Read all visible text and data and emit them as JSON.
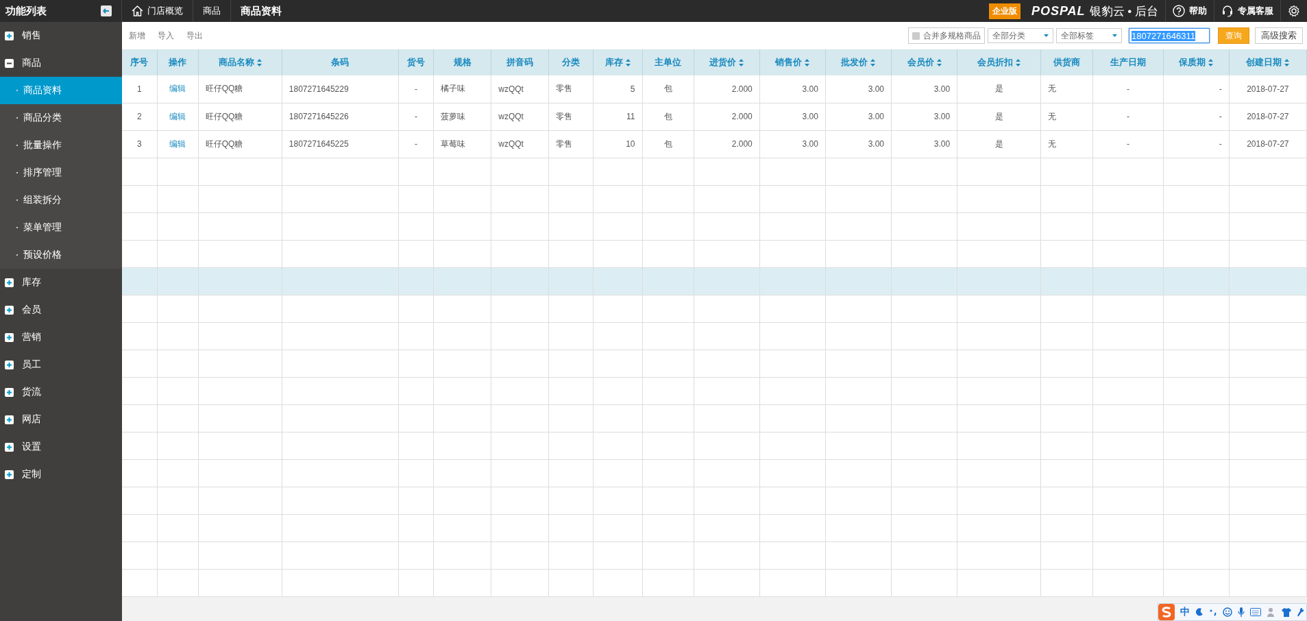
{
  "sidebar": {
    "title": "功能列表",
    "groups": [
      {
        "label": "销售",
        "expanded": false
      },
      {
        "label": "商品",
        "expanded": true,
        "children": [
          {
            "label": "商品资料",
            "selected": true
          },
          {
            "label": "商品分类",
            "selected": false
          },
          {
            "label": "批量操作",
            "selected": false
          },
          {
            "label": "排序管理",
            "selected": false
          },
          {
            "label": "组装拆分",
            "selected": false
          },
          {
            "label": "菜单管理",
            "selected": false
          },
          {
            "label": "预设价格",
            "selected": false
          }
        ]
      },
      {
        "label": "库存",
        "expanded": false
      },
      {
        "label": "会员",
        "expanded": false
      },
      {
        "label": "营销",
        "expanded": false
      },
      {
        "label": "员工",
        "expanded": false
      },
      {
        "label": "货流",
        "expanded": false
      },
      {
        "label": "网店",
        "expanded": false
      },
      {
        "label": "设置",
        "expanded": false
      },
      {
        "label": "定制",
        "expanded": false
      }
    ]
  },
  "breadcrumb": [
    {
      "label": "门店概览",
      "kind": "home",
      "current": false
    },
    {
      "label": "商品",
      "kind": "plain",
      "current": false
    },
    {
      "label": "商品资料",
      "kind": "plain",
      "current": true
    }
  ],
  "header_right": {
    "edition_badge": "企业版",
    "brand": "POSPAL",
    "product": "银豹云",
    "separator": "•",
    "suffix": "后台",
    "links": [
      {
        "label": "帮助",
        "kind": "help"
      },
      {
        "label": "专属客服",
        "kind": "service"
      },
      {
        "kind": "settings"
      }
    ]
  },
  "toolbar": {
    "actions": [
      "新增",
      "导入",
      "导出"
    ],
    "merge_checkbox": {
      "label": "合并多规格商品",
      "checked": false
    },
    "filters": [
      "全部分类",
      "全部标签"
    ],
    "search": {
      "value": "1807271646311",
      "text_selected": true
    },
    "query_button": "查询",
    "advanced_button": "高级搜索"
  },
  "table": {
    "columns": [
      {
        "label": "序号",
        "sortable": false
      },
      {
        "label": "操作",
        "sortable": false
      },
      {
        "label": "商品名称",
        "sortable": true
      },
      {
        "label": "条码",
        "sortable": false
      },
      {
        "label": "货号",
        "sortable": false
      },
      {
        "label": "规格",
        "sortable": false
      },
      {
        "label": "拼音码",
        "sortable": false
      },
      {
        "label": "分类",
        "sortable": false
      },
      {
        "label": "库存",
        "sortable": true
      },
      {
        "label": "主单位",
        "sortable": false
      },
      {
        "label": "进货价",
        "sortable": true
      },
      {
        "label": "销售价",
        "sortable": true
      },
      {
        "label": "批发价",
        "sortable": true
      },
      {
        "label": "会员价",
        "sortable": true
      },
      {
        "label": "会员折扣",
        "sortable": true
      },
      {
        "label": "供货商",
        "sortable": false
      },
      {
        "label": "生产日期",
        "sortable": false
      },
      {
        "label": "保质期",
        "sortable": true
      },
      {
        "label": "创建日期",
        "sortable": true
      }
    ],
    "rows": [
      [
        "1",
        "编辑",
        "旺仔QQ糖",
        "1807271645229",
        "-",
        "橘子味",
        "wzQQt",
        "零售",
        "5",
        "包",
        "2.000",
        "3.00",
        "3.00",
        "3.00",
        "是",
        "无",
        "-",
        "-",
        "2018-07-27"
      ],
      [
        "2",
        "编辑",
        "旺仔QQ糖",
        "1807271645226",
        "-",
        "菠萝味",
        "wzQQt",
        "零售",
        "11",
        "包",
        "2.000",
        "3.00",
        "3.00",
        "3.00",
        "是",
        "无",
        "-",
        "-",
        "2018-07-27"
      ],
      [
        "3",
        "编辑",
        "旺仔QQ糖",
        "1807271645225",
        "-",
        "草莓味",
        "wzQQt",
        "零售",
        "10",
        "包",
        "2.000",
        "3.00",
        "3.00",
        "3.00",
        "是",
        "无",
        "-",
        "-",
        "2018-07-27"
      ]
    ],
    "blank_rows": [
      {
        "hovered": false
      },
      {
        "hovered": false
      },
      {
        "hovered": false
      },
      {
        "hovered": false
      },
      {
        "hovered": true
      },
      {
        "hovered": false
      },
      {
        "hovered": false
      },
      {
        "hovered": false
      },
      {
        "hovered": false
      },
      {
        "hovered": false
      },
      {
        "hovered": false
      },
      {
        "hovered": false
      },
      {
        "hovered": false
      },
      {
        "hovered": false
      },
      {
        "hovered": false
      },
      {
        "hovered": false
      }
    ]
  },
  "ime_toolbar": {
    "mode": "中"
  }
}
